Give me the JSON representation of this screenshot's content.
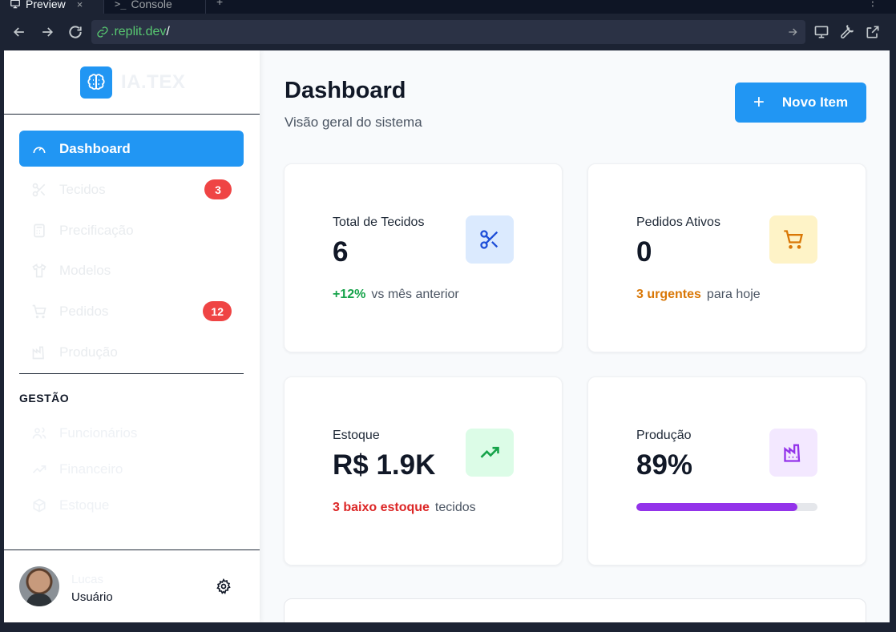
{
  "chrome": {
    "tabs": [
      {
        "label": "Preview",
        "close": "×"
      },
      {
        "label": "Console"
      }
    ],
    "plus": "+",
    "kebab": "⋮",
    "url": {
      "host": ".replit.dev",
      "path": "/"
    }
  },
  "sidebar": {
    "logo_text": "IA.TEX",
    "items": [
      {
        "label": "Dashboard",
        "icon": "gauge-icon",
        "active": true
      },
      {
        "label": "Tecidos",
        "icon": "scissors-icon",
        "badge": "3"
      },
      {
        "label": "Precificação",
        "icon": "calculator-icon"
      },
      {
        "label": "Modelos",
        "icon": "shirt-icon"
      },
      {
        "label": "Pedidos",
        "icon": "cart-icon",
        "badge": "12"
      },
      {
        "label": "Produção",
        "icon": "factory-icon"
      }
    ],
    "section_label": "GESTÃO",
    "management": [
      {
        "label": "Funcionários",
        "icon": "users-icon"
      },
      {
        "label": "Financeiro",
        "icon": "trend-icon"
      },
      {
        "label": "Estoque",
        "icon": "box-icon"
      }
    ],
    "user": {
      "name": "Lucas",
      "role": "Usuário"
    }
  },
  "header": {
    "title": "Dashboard",
    "subtitle": "Visão geral do sistema",
    "new_button": "Novo Item",
    "new_button_icon": "+"
  },
  "cards": [
    {
      "label": "Total de Tecidos",
      "value": "6",
      "highlight": "+12%",
      "highlight_color": "#16a34a",
      "note": "vs mês anterior",
      "icon": "scissors-icon",
      "icon_bg": "#dbeafe",
      "icon_color": "#1d4ed8"
    },
    {
      "label": "Pedidos Ativos",
      "value": "0",
      "highlight": "3 urgentes",
      "highlight_color": "#d97706",
      "note": "para hoje",
      "icon": "cart-icon",
      "icon_bg": "#fef3c7",
      "icon_color": "#d97706"
    },
    {
      "label": "Estoque",
      "value": "R$ 1.9K",
      "highlight": "3 baixo estoque",
      "highlight_color": "#dc2626",
      "note": "tecidos",
      "icon": "trending-up-icon",
      "icon_bg": "#dcfce7",
      "icon_color": "#16a34a"
    },
    {
      "label": "Produção",
      "value": "89%",
      "progress": 0.89,
      "icon": "factory-icon",
      "icon_bg": "#f3e8ff",
      "icon_color": "#9333ea"
    }
  ]
}
